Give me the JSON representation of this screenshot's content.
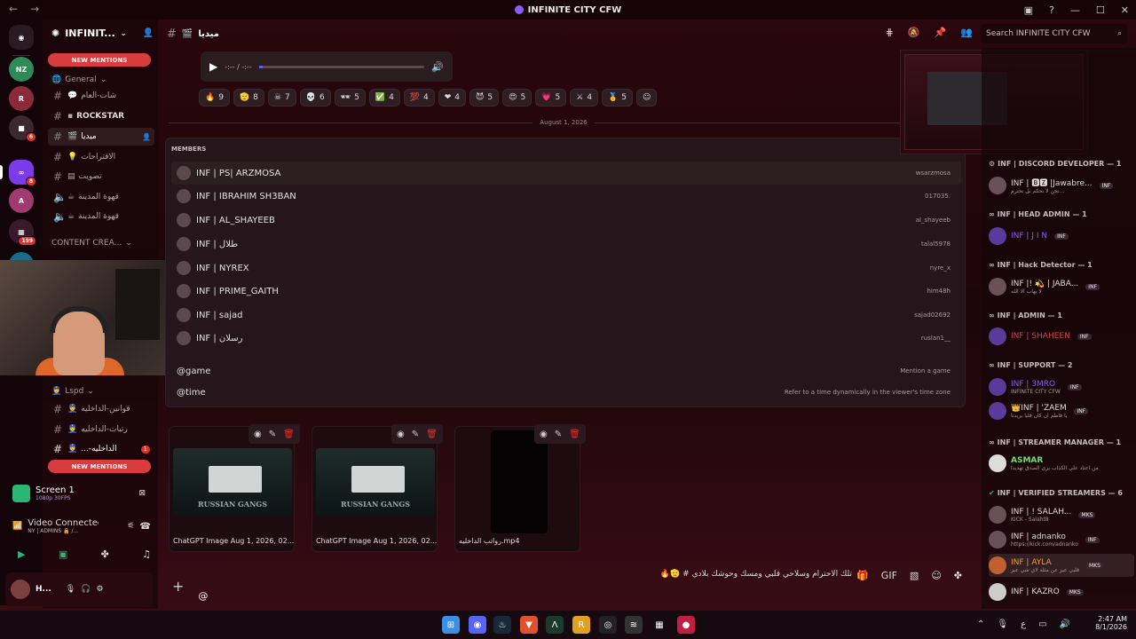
{
  "window": {
    "title": "INFINITE CITY CFW"
  },
  "server": {
    "name": "INFINIT...",
    "new_mentions_top": "NEW MENTIONS",
    "new_mentions_bottom": "NEW MENTIONS"
  },
  "server_badges": [
    "6",
    "8",
    "199"
  ],
  "categories": {
    "general": "General",
    "content": "CONTENT CREA...",
    "lspd": "Lspd"
  },
  "channels": [
    {
      "name": "شات-العام",
      "icon": "💬"
    },
    {
      "name": "ROCKSTAR",
      "icon": ""
    },
    {
      "name": "ميديا",
      "icon": "🎬"
    },
    {
      "name": "الاقتراحات",
      "icon": "💡"
    },
    {
      "name": "تصويت",
      "icon": ""
    },
    {
      "name": "قهوة المدينة",
      "icon": ""
    },
    {
      "name": "قهوة المدينة",
      "icon": ""
    }
  ],
  "lspd_channels": [
    {
      "name": "قوانين-الداخليه"
    },
    {
      "name": "رتبات-الداخليه"
    },
    {
      "name": "...-الداخليه",
      "badge": "1"
    }
  ],
  "voice": {
    "stream_title": "Screen 1",
    "stream_quality": "1080p 30FPS",
    "status": "Video Connected",
    "channel": "NY | ADMINS 🔒 /..."
  },
  "user": {
    "name": "H..."
  },
  "topbar": {
    "channel": "ميديا",
    "search_placeholder": "Search INFINITE CITY CFW"
  },
  "player": {
    "time": "-:-- / -:--"
  },
  "reactions": [
    {
      "emoji": "🔥",
      "count": "9"
    },
    {
      "emoji": "🫡",
      "count": "8"
    },
    {
      "emoji": "☠",
      "count": "7"
    },
    {
      "emoji": "💀",
      "count": "6"
    },
    {
      "emoji": "🕶",
      "count": "5"
    },
    {
      "emoji": "✅",
      "count": "4"
    },
    {
      "emoji": "💯",
      "count": "4"
    },
    {
      "emoji": "❤",
      "count": "4"
    },
    {
      "emoji": "😈",
      "count": "5"
    },
    {
      "emoji": "😍",
      "count": "5"
    },
    {
      "emoji": "💗",
      "count": "5"
    },
    {
      "emoji": "⚔",
      "count": "4"
    },
    {
      "emoji": "🏅",
      "count": "5"
    }
  ],
  "date_divider": "August 1, 2026",
  "popup": {
    "title": "MEMBERS",
    "members": [
      {
        "name": "INF | PS| ARZMOSA",
        "handle": "wsarzmosa"
      },
      {
        "name": "INF | IBRAHIM SH3BAN",
        "handle": "017035."
      },
      {
        "name": "INF | AL_SHAYEEB",
        "handle": "al_shayeeb"
      },
      {
        "name": "INF | طلال",
        "handle": "talal5978"
      },
      {
        "name": "INF | NYREX",
        "handle": "nyre_x"
      },
      {
        "name": "INF | PRIME_GAITH",
        "handle": "him48h"
      },
      {
        "name": "INF | sajad",
        "handle": "sajad02692"
      },
      {
        "name": "INF | رسلان",
        "handle": "ruslan1__"
      }
    ],
    "commands": [
      {
        "name": "@game",
        "desc": "Mention a game"
      },
      {
        "name": "@time",
        "desc": "Refer to a time dynamically in the viewer's time zone"
      }
    ]
  },
  "attachments": [
    {
      "name": "ChatGPT Image Aug 1, 2026, 02...",
      "overlay": "RUSSIAN GANGS"
    },
    {
      "name": "ChatGPT Image Aug 1, 2026, 02...",
      "overlay": "RUSSIAN GANGS"
    },
    {
      "name": "رواتب الداخليه.mp4",
      "overlay": ""
    }
  ],
  "composer": {
    "text": "@",
    "trailing_text": "🔥🫡 # تلك الاحترام وسلاحي قلبي ومسك وحوشك بلادي"
  },
  "member_list": [
    {
      "category": "INF | DISCORD DEVELOPER — 1",
      "members": [
        {
          "name": "INF | 🅱🆉 |Jawabre...",
          "tag": "INF",
          "sub": "نحن لا نحكم بل نحترم..."
        }
      ]
    },
    {
      "category": "INF | HEAD ADMIN — 1",
      "members": [
        {
          "name": "INF | J I N",
          "tag": "INF",
          "sub": ""
        }
      ]
    },
    {
      "category": "INF | Hack Detector — 1",
      "members": [
        {
          "name": "INF |! 💫 | JABA...",
          "tag": "INF",
          "sub": "لا يهاب الا الله"
        }
      ]
    },
    {
      "category": "INF | ADMIN — 1",
      "members": [
        {
          "name": "INF | SHAHEEN",
          "tag": "INF",
          "sub": ""
        }
      ]
    },
    {
      "category": "INF | SUPPORT — 2",
      "members": [
        {
          "name": "INF | 3MRO",
          "tag": "INF",
          "sub": "INFINITE CITY CFW"
        },
        {
          "name": "👑INF | 'ZÄEM",
          "tag": "INF",
          "sub": "يا فاطم ان كان قلبا يريدنا"
        }
      ]
    },
    {
      "category": "INF | STREAMER MANAGER — 1",
      "members": [
        {
          "name": "ASMAR",
          "tag": "",
          "sub": "من اعتاد على الكذاب يرى الصدق تهديدا"
        }
      ]
    },
    {
      "category": "INF | VERIFIED STREAMERS — 6",
      "members": [
        {
          "name": "INF | ! SALAH...",
          "tag": "MKS",
          "sub": "KICK - Salaht8"
        },
        {
          "name": "INF | adnanko",
          "tag": "INF",
          "sub": "https://kick.com/adnanko"
        },
        {
          "name": "INF | AYLA",
          "tag": "MKS",
          "sub": "قلبي عيز عن مثله لاي شي عيز"
        },
        {
          "name": "INF | KAZRO",
          "tag": "MKS",
          "sub": ""
        }
      ]
    }
  ],
  "clock": {
    "time": "2:47 AM",
    "date": "8/1/2026"
  },
  "colors": {
    "accent": "#d83c3e",
    "background": "#1c0609",
    "brand": "#5865f2"
  }
}
